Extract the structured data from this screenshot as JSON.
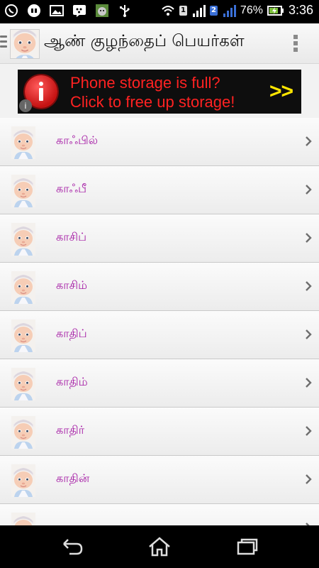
{
  "status_bar": {
    "battery_percent": "76%",
    "time": "3:36",
    "sim1": "1",
    "sim2": "2",
    "left_icons": [
      "whatsapp-icon",
      "hike-icon",
      "image-icon",
      "bbm-icon",
      "cat-game-icon",
      "usb-icon"
    ]
  },
  "app_bar": {
    "title": "ஆண் குழந்தைப் பெயர்கள்"
  },
  "ad": {
    "line1": "Phone storage is full?",
    "line2": "Click to free up storage!",
    "arrows": ">>",
    "info": "i"
  },
  "names": [
    {
      "name": "காஃபில்"
    },
    {
      "name": "காஃபீ"
    },
    {
      "name": "காசிப்"
    },
    {
      "name": "காசிம்"
    },
    {
      "name": "காதிப்"
    },
    {
      "name": "காதிம்"
    },
    {
      "name": "காதிர்"
    },
    {
      "name": "காதின்"
    },
    {
      "name": ""
    }
  ],
  "nav_bar": {
    "icons": [
      "back-icon",
      "home-icon",
      "recents-icon"
    ]
  },
  "colors": {
    "name_text": "#a51ca5",
    "ad_text": "#ff2222",
    "ad_arrows": "#ffe600"
  }
}
